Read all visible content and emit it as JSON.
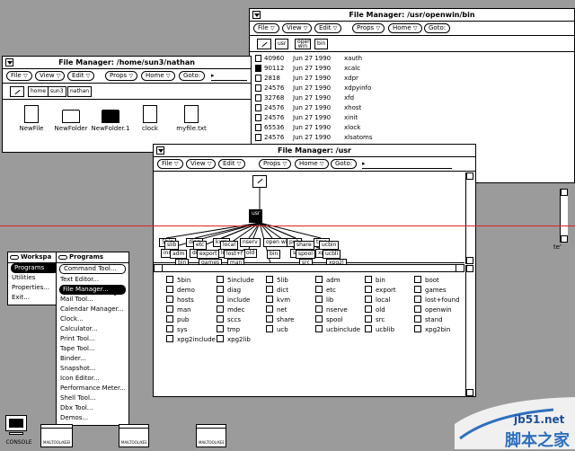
{
  "colors": {
    "desktop": "#9b9b9b",
    "window": "#ffffff",
    "ink": "#000000",
    "accent_line": "#d22222",
    "watermark_bg": "#ffffff"
  },
  "menubar": {
    "file": "File",
    "view": "View",
    "edit": "Edit",
    "props": "Props",
    "home": "Home",
    "goto": "Goto:"
  },
  "win_bin": {
    "title": "File Manager: /usr/openwin/bin",
    "path": [
      "usr",
      "open win",
      "bin"
    ],
    "files": [
      {
        "size": "40960",
        "date": "Jun 27 1990",
        "name": "xauth",
        "filled": false
      },
      {
        "size": "90112",
        "date": "Jun 27 1990",
        "name": "xcalc",
        "filled": true
      },
      {
        "size": "2818",
        "date": "Jun 27 1990",
        "name": "xdpr",
        "filled": false
      },
      {
        "size": "24576",
        "date": "Jun 27 1990",
        "name": "xdpyinfo",
        "filled": false
      },
      {
        "size": "32768",
        "date": "Jun 27 1990",
        "name": "xfd",
        "filled": false
      },
      {
        "size": "24576",
        "date": "Jun 27 1990",
        "name": "xhost",
        "filled": false
      },
      {
        "size": "24576",
        "date": "Jun 27 1990",
        "name": "xinit",
        "filled": false
      },
      {
        "size": "65536",
        "date": "Jun 27 1990",
        "name": "xlock",
        "filled": false
      },
      {
        "size": "24576",
        "date": "Jun 27 1990",
        "name": "xlsatoms",
        "filled": false
      }
    ],
    "fragment": "te'"
  },
  "win_home": {
    "title": "File Manager: /home/sun3/nathan",
    "path": [
      "home",
      "sun3",
      "nathan"
    ],
    "icons": [
      {
        "label": "NewFile",
        "kind": "doc"
      },
      {
        "label": "NewFolder",
        "kind": "folder"
      },
      {
        "label": "NewFolder.1",
        "kind": "folder-black"
      },
      {
        "label": "clock",
        "kind": "doc"
      },
      {
        "label": "myfile.txt",
        "kind": "doc"
      }
    ]
  },
  "win_usr": {
    "title": "File Manager: /usr",
    "root": "usr",
    "tree_nodes": [
      "5bin",
      "diag",
      "kvm",
      "nserv",
      "open win",
      "pub",
      "tmp",
      "inclu",
      "dict",
      "lib",
      "old",
      "sccs",
      "xpg2",
      "slib",
      "etc",
      "local",
      "share",
      "ucbin",
      "adm",
      "export",
      "lost+f",
      "spool",
      "ucbli",
      "bin",
      "games",
      "man",
      "bin",
      "src",
      "xpg2l"
    ],
    "items": [
      "5bin",
      "5include",
      "5lib",
      "adm",
      "bin",
      "boot",
      "demo",
      "diag",
      "dict",
      "etc",
      "export",
      "games",
      "hosts",
      "include",
      "kvm",
      "lib",
      "local",
      "lost+found",
      "man",
      "mdec",
      "net",
      "nserve",
      "old",
      "openwin",
      "pub",
      "sccs",
      "share",
      "spool",
      "src",
      "stand",
      "sys",
      "tmp",
      "ucb",
      "ucbinclude",
      "ucblib",
      "xpg2bin",
      "xpg2include",
      "xpg2lib"
    ]
  },
  "workspace_menu": {
    "title": "Workspa",
    "items": [
      "Programs",
      "Utilities",
      "Properties...",
      "Exit..."
    ]
  },
  "programs_menu": {
    "title": "Programs",
    "items": [
      "Command Tool...",
      "Text Editor...",
      "File Manager...",
      "Mail Tool...",
      "Calendar Manager...",
      "Clock...",
      "Calculator...",
      "Print Tool...",
      "Tape Tool...",
      "Binder...",
      "Snapshot...",
      "Icon Editor...",
      "Performance Meter...",
      "Shell Tool...",
      "Dbx Tool...",
      "Demos..."
    ]
  },
  "bottom_icons": {
    "console": "CONSOLE",
    "window_icon": "MAILTOOL/KEEPCALIF"
  },
  "watermark": {
    "site": "jb51.net",
    "cn": "脚本之家"
  }
}
